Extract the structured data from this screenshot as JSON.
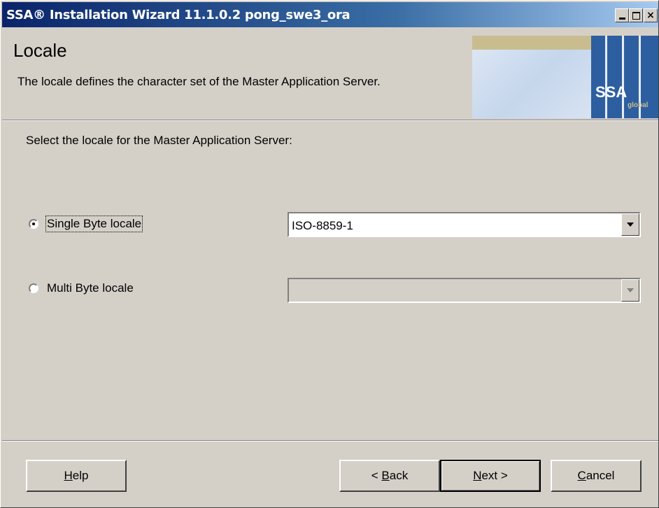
{
  "window": {
    "title": "SSA® Installation Wizard 11.1.0.2 pong_swe3_ora",
    "controls": {
      "minimize_icon": "minimize-icon",
      "maximize_icon": "maximize-icon",
      "close_icon": "close-icon",
      "close_glyph": "×"
    }
  },
  "header": {
    "title": "Locale",
    "description": "The locale defines the character set of the Master Application Server.",
    "logo": {
      "text": "SSA",
      "subtext": "global"
    }
  },
  "content": {
    "prompt": "Select the locale for the Master Application Server:",
    "options": [
      {
        "label": "Single Byte locale",
        "checked": true,
        "value": "ISO-8859-1",
        "enabled": true
      },
      {
        "label": "Multi Byte locale",
        "checked": false,
        "value": "",
        "enabled": false
      }
    ]
  },
  "footer": {
    "help": {
      "prefix": "",
      "mnemonic": "H",
      "rest": "elp"
    },
    "back": {
      "prefix": "< ",
      "mnemonic": "B",
      "rest": "ack"
    },
    "next": {
      "prefix": "",
      "mnemonic": "N",
      "rest": "ext >"
    },
    "cancel": {
      "prefix": "",
      "mnemonic": "C",
      "rest": "ancel"
    }
  },
  "colors": {
    "titlebar_start": "#0a246a",
    "titlebar_end": "#a6caf0",
    "dialog_bg": "#d4d0c8",
    "logo_blue": "#2d5fa0"
  }
}
